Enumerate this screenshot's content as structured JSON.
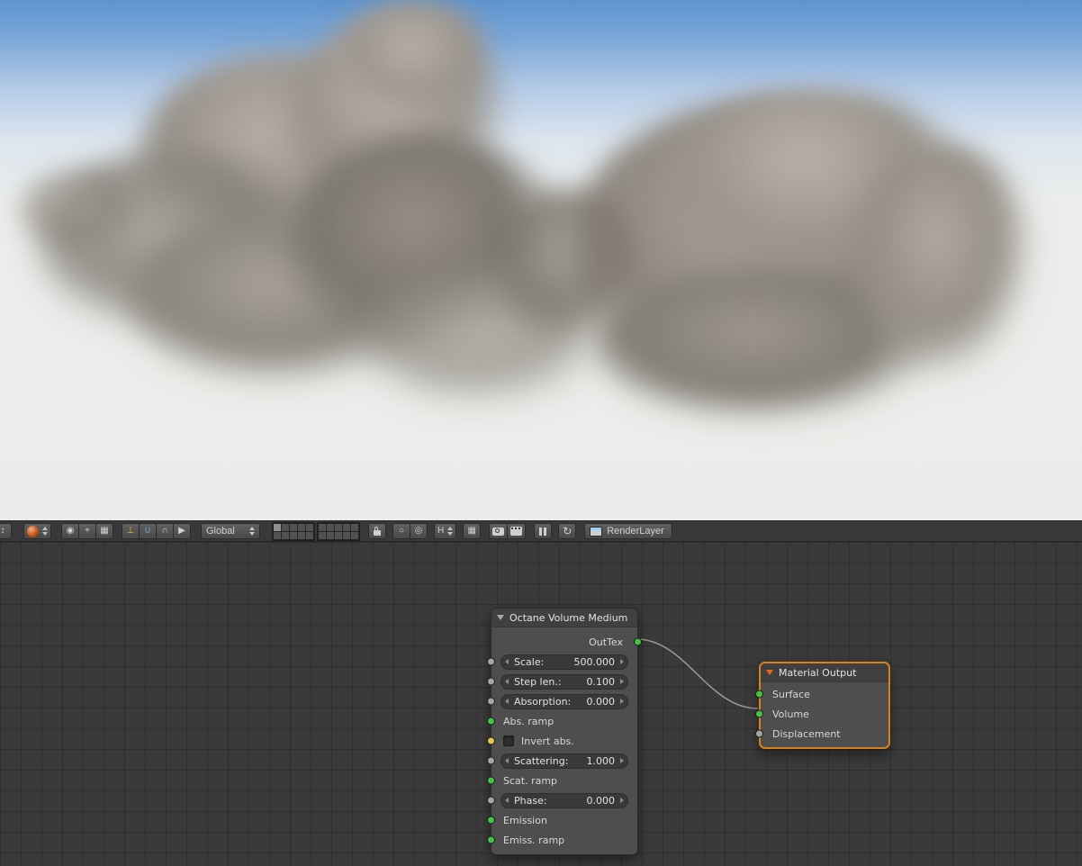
{
  "header": {
    "orientation": "Global",
    "render_layer": "RenderLayer",
    "icons": [
      {
        "name": "editor-type",
        "glyph": "↕"
      },
      {
        "name": "viewport-shading",
        "glyph": ""
      },
      {
        "name": "pivot-point",
        "glyph": "◉"
      },
      {
        "name": "manipulator",
        "glyph": "+"
      },
      {
        "name": "layer-visibility",
        "glyph": "▦"
      },
      {
        "name": "axis-gizmo",
        "glyph": "⊥"
      },
      {
        "name": "snap-magnet",
        "glyph": "∪"
      },
      {
        "name": "curve-falloff",
        "glyph": "∩"
      },
      {
        "name": "mouse-cursor",
        "glyph": "▶"
      },
      {
        "name": "proportional-edit",
        "glyph": "○"
      },
      {
        "name": "snap-target",
        "glyph": "◎"
      },
      {
        "name": "snap-element",
        "glyph": "H"
      },
      {
        "name": "background-grid",
        "glyph": "▦"
      },
      {
        "name": "refresh",
        "glyph": "↻"
      }
    ]
  },
  "nodes": {
    "octane": {
      "title": "Octane Volume Medium",
      "out_label": "OutTex",
      "rows": [
        {
          "label": "Scale:",
          "value": "500.000"
        },
        {
          "label": "Step len.:",
          "value": "0.100"
        },
        {
          "label": "Absorption:",
          "value": "0.000"
        },
        {
          "label": "Abs. ramp"
        },
        {
          "label": "Invert abs."
        },
        {
          "label": "Scattering:",
          "value": "1.000"
        },
        {
          "label": "Scat. ramp"
        },
        {
          "label": "Phase:",
          "value": "0.000"
        },
        {
          "label": "Emission"
        },
        {
          "label": "Emiss. ramp"
        }
      ]
    },
    "material_output": {
      "title": "Material Output",
      "inputs": [
        {
          "label": "Surface"
        },
        {
          "label": "Volume"
        },
        {
          "label": "Displacement"
        }
      ]
    }
  },
  "colors": {
    "selection_outline": "#d8821e",
    "socket_green": "#44c444",
    "socket_yellow": "#e3c94c",
    "socket_gray": "#a4a4a4",
    "header_triangle_orange": "#e8641f"
  }
}
